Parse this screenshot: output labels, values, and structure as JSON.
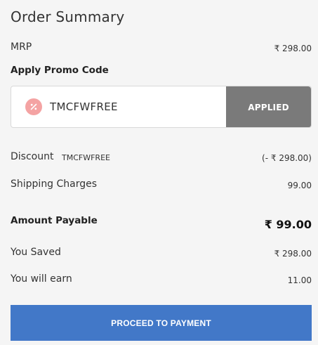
{
  "title": "Order Summary",
  "mrp": {
    "label": "MRP",
    "value": "₹ 298.00"
  },
  "promo": {
    "heading": "Apply Promo Code",
    "icon": "percent-badge-icon",
    "code": "TMCFWFREE",
    "button_label": "APPLIED"
  },
  "discount": {
    "label": "Discount",
    "code": "TMCFWFREE",
    "value": "(- ₹ 298.00)"
  },
  "shipping": {
    "label": "Shipping Charges",
    "value": "99.00"
  },
  "payable": {
    "label": "Amount Payable",
    "value": "₹ 99.00"
  },
  "saved": {
    "label": "You Saved",
    "value": "₹ 298.00"
  },
  "earn": {
    "label": "You will earn",
    "value": "11.00"
  },
  "proceed": {
    "label": "PROCEED TO PAYMENT"
  },
  "colors": {
    "applied_button": "#7a7a7a",
    "proceed_button": "#4278c8",
    "promo_icon": "#f4a3a3"
  }
}
